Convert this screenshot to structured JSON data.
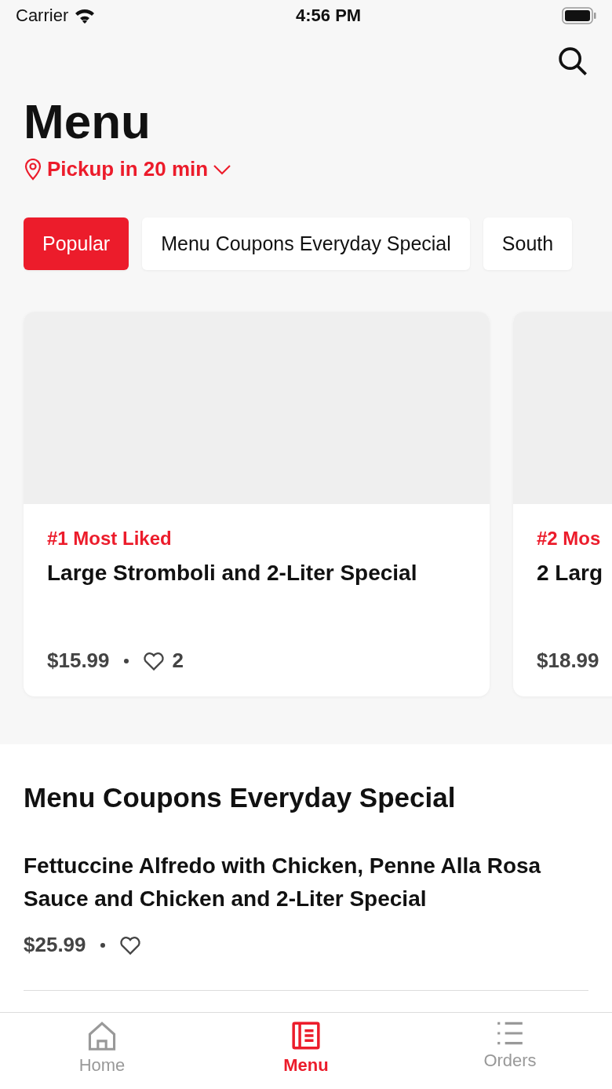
{
  "status_bar": {
    "carrier": "Carrier",
    "time": "4:56 PM"
  },
  "title": "Menu",
  "pickup": "Pickup in 20 min",
  "categories": [
    {
      "label": "Popular",
      "selected": true
    },
    {
      "label": "Menu Coupons Everyday Special",
      "selected": false
    },
    {
      "label": "South",
      "selected": false
    }
  ],
  "popular": [
    {
      "rank": "#1 Most Liked",
      "name": "Large Stromboli and 2-Liter Special",
      "price": "$15.99",
      "likes": "2"
    },
    {
      "rank": "#2 Mos",
      "name": "2 Larg",
      "price": "$18.99"
    }
  ],
  "section": {
    "title": "Menu Coupons Everyday Special",
    "items": [
      {
        "name": "Fettuccine Alfredo with Chicken, Penne Alla Rosa Sauce and Chicken and 2-Liter Special",
        "price": "$25.99"
      }
    ]
  },
  "tab_bar": [
    {
      "label": "Home",
      "selected": false
    },
    {
      "label": "Menu",
      "selected": true
    },
    {
      "label": "Orders",
      "selected": false
    }
  ]
}
